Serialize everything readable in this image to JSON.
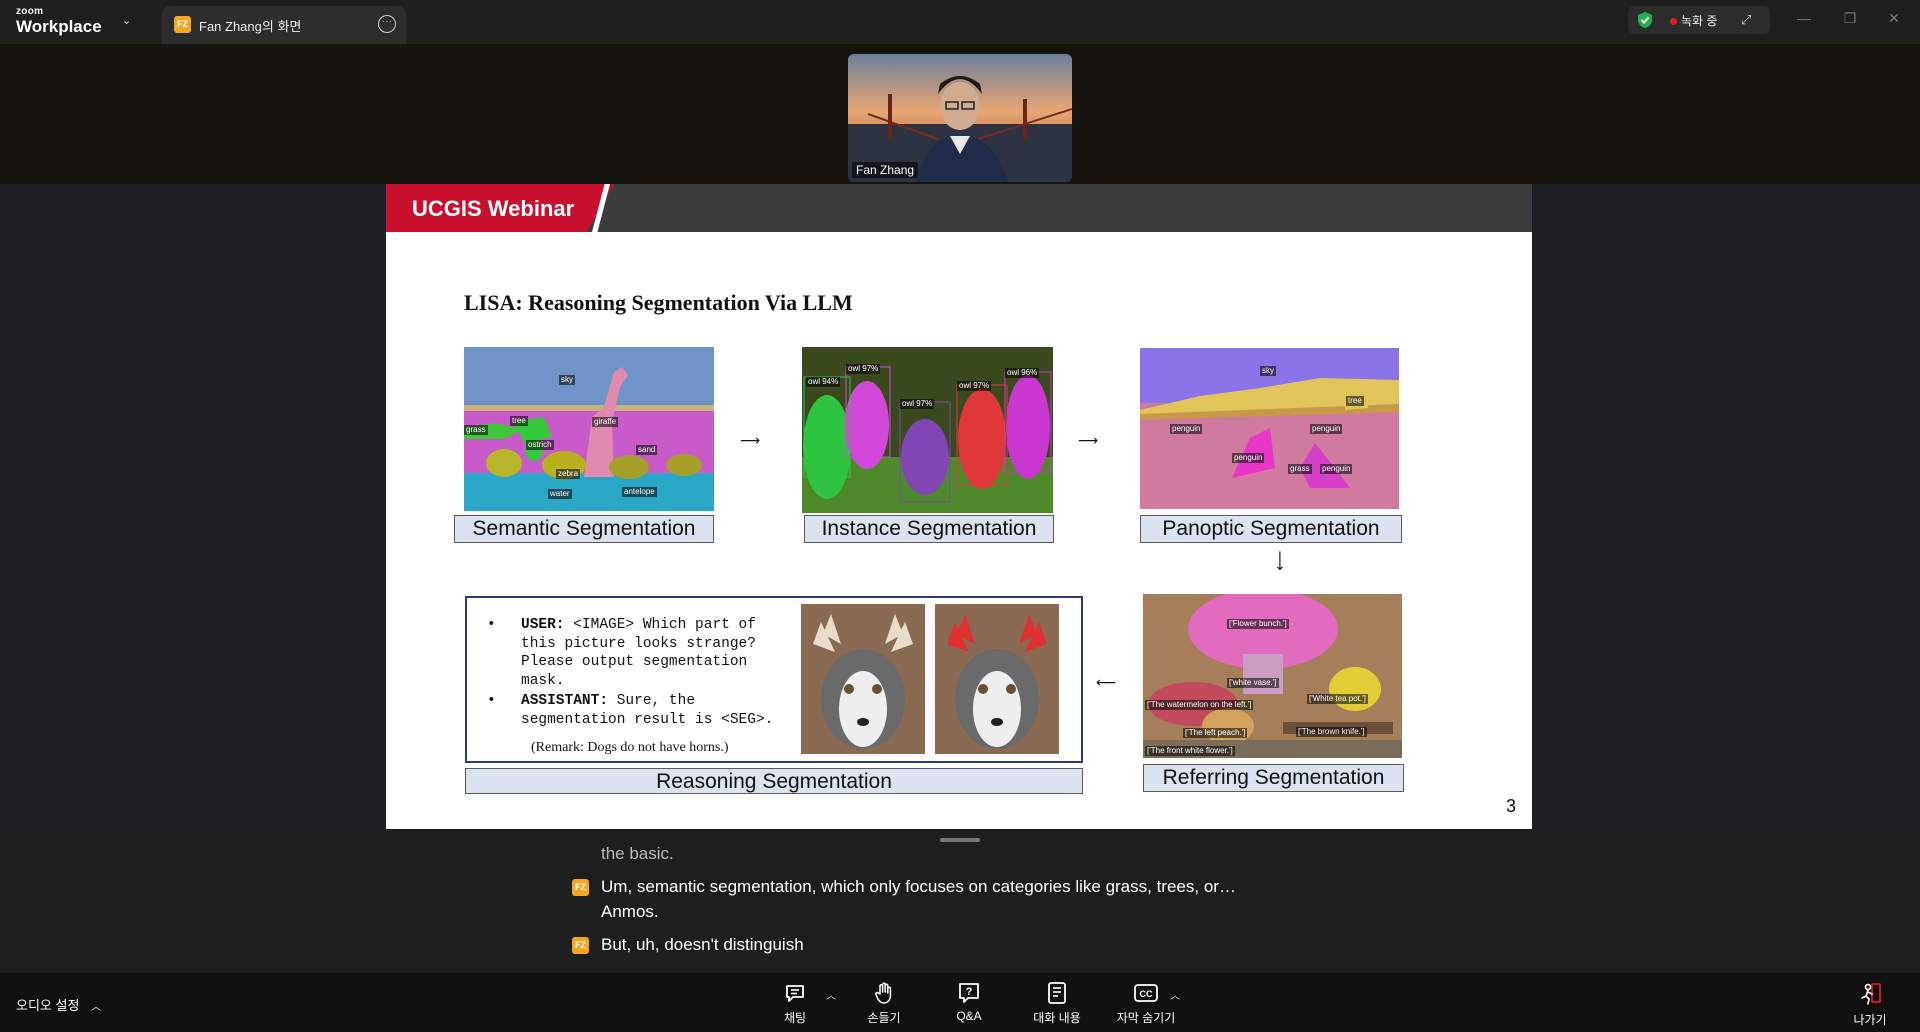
{
  "titlebar": {
    "brand_small": "zoom",
    "brand_big": "Workplace",
    "tab_badge": "FZ",
    "tab_label": "Fan Zhang의 화면",
    "recording_label": "녹화 중"
  },
  "video": {
    "participant_name": "Fan Zhang"
  },
  "slide": {
    "header_title": "UCGIS Webinar",
    "title": "LISA: Reasoning Segmentation Via LLM",
    "captions": {
      "semantic": "Semantic Segmentation",
      "instance": "Instance Segmentation",
      "panoptic": "Panoptic Segmentation",
      "reasoning": "Reasoning Segmentation",
      "referring": "Referring Segmentation"
    },
    "semantic_labels": [
      "sky",
      "giraffe",
      "tree",
      "grass",
      "ostrich",
      "sand",
      "zebra",
      "water",
      "antelope"
    ],
    "instance_labels": [
      "owl 94%",
      "owl 97%",
      "owl 97%",
      "owl 97%",
      "owl 96%"
    ],
    "panoptic_labels": [
      "sky",
      "tree",
      "penguin",
      "penguin",
      "penguin",
      "grass",
      "penguin"
    ],
    "referring_labels": [
      "['Flower bunch.']",
      "['white vase.']",
      "['The watermelon on the left.']",
      "['White tea pot.']",
      "['The left peach.']",
      "['The brown knife.']",
      "['The front white flower.']"
    ],
    "dialog": {
      "user_label": "USER:",
      "user_text": "<IMAGE> Which part of this picture looks strange? Please output segmentation mask.",
      "assistant_label": "ASSISTANT:",
      "assistant_text": "Sure, the segmentation result is <SEG>.",
      "remark": "(Remark: Dogs do not have horns.)",
      "bullet": "•"
    },
    "page_number": "3"
  },
  "transcript": {
    "partial": "the basic.",
    "badge": "FZ",
    "line1": "Um, semantic segmentation, which only focuses on categories like grass, trees, or…",
    "line1b": "Anmos.",
    "line2": "But, uh, doesn't distinguish"
  },
  "toolbar": {
    "audio_settings": "오디오 설정",
    "chat": "채팅",
    "raise_hand": "손들기",
    "qa": "Q&A",
    "transcript": "대화 내용",
    "hide_captions": "자막 숨기기",
    "leave": "나가기"
  },
  "colors": {
    "accent_red": "#c8102e",
    "zoom_badge": "#f5a623",
    "recording_dot": "#e02020"
  }
}
